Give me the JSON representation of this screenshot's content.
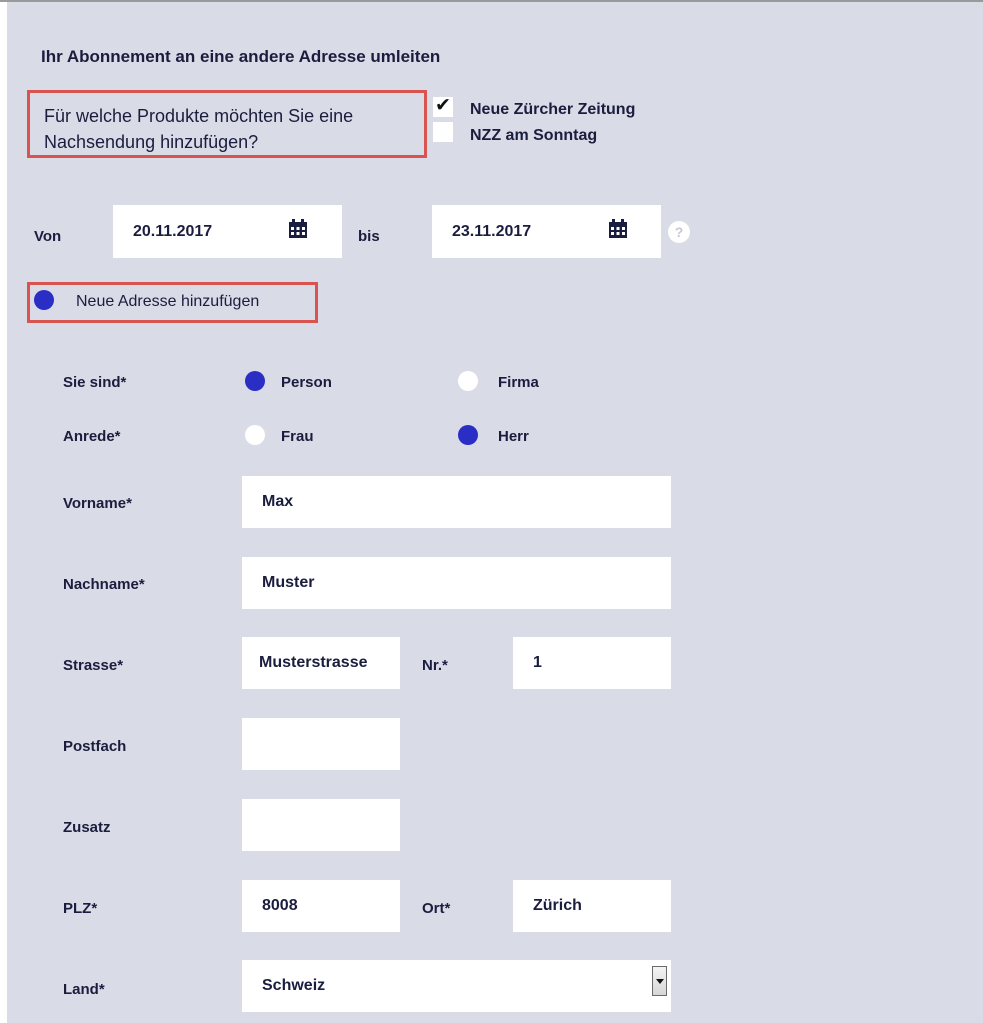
{
  "form": {
    "heading": "Ihr Abonnement an eine andere Adresse umleiten",
    "question": "Für welche Produkte möchten Sie eine Nachsendung hinzufügen?",
    "products": [
      {
        "label": "Neue Zürcher Zeitung",
        "checked": true
      },
      {
        "label": "NZZ am Sonntag",
        "checked": false
      }
    ],
    "date_from_label": "Von",
    "date_from": "20.11.2017",
    "date_to_label": "bis",
    "date_to": "23.11.2017",
    "help_icon": "?",
    "new_address_label": "Neue Adresse hinzufügen",
    "new_address_selected": true,
    "type_label": "Sie sind*",
    "type_options": [
      {
        "label": "Person",
        "selected": true
      },
      {
        "label": "Firma",
        "selected": false
      }
    ],
    "salutation_label": "Anrede*",
    "salutation_options": [
      {
        "label": "Frau",
        "selected": false
      },
      {
        "label": "Herr",
        "selected": true
      }
    ],
    "firstname_label": "Vorname*",
    "firstname": "Max",
    "lastname_label": "Nachname*",
    "lastname": "Muster",
    "street_label": "Strasse*",
    "street": "Musterstrasse",
    "number_label": "Nr.*",
    "number": "1",
    "pobox_label": "Postfach",
    "pobox": "",
    "addition_label": "Zusatz",
    "addition": "",
    "zip_label": "PLZ*",
    "zip": "8008",
    "city_label": "Ort*",
    "city": "Zürich",
    "country_label": "Land*",
    "country": "Schweiz"
  },
  "icons": {
    "calendar": "calendar-icon",
    "check": "checkmark-icon",
    "help": "question-icon",
    "dropdown": "chevron-down-icon"
  },
  "colors": {
    "panel_bg": "#d9dbe6",
    "text": "#1b1d3f",
    "accent_radio": "#2b2ec4",
    "highlight_border": "#d9534f"
  }
}
